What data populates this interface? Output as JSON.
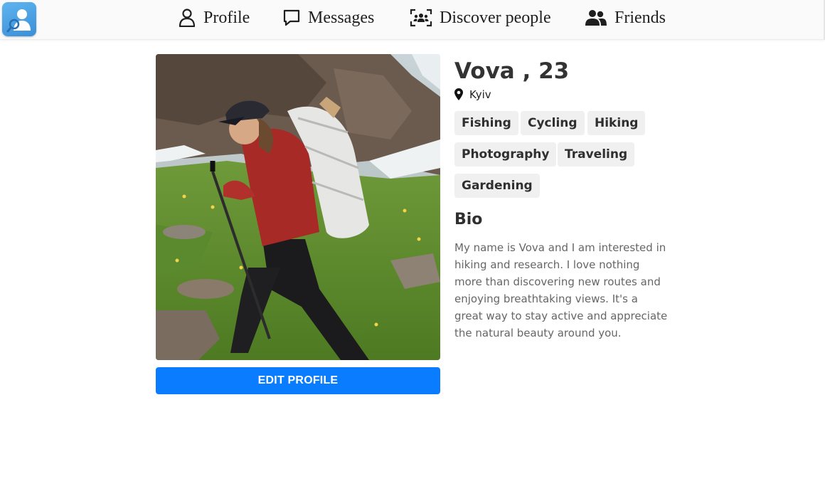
{
  "nav": {
    "items": [
      {
        "label": "Profile",
        "icon": "user-outline-icon"
      },
      {
        "label": "Messages",
        "icon": "chat-bubble-icon"
      },
      {
        "label": "Discover people",
        "icon": "discover-people-icon"
      },
      {
        "label": "Friends",
        "icon": "friends-icon"
      }
    ]
  },
  "profile": {
    "name": "Vova , 23",
    "location": "Kyiv",
    "interests": [
      "Fishing",
      "Cycling",
      "Hiking",
      "Photography",
      "Traveling",
      "Gardening"
    ],
    "bio_title": "Bio",
    "bio": "My name is Vova and I am interested in hiking and research. I love nothing more than discovering new routes and enjoying breathtaking views. It's a great way to stay active and appreciate the natural beauty around you.",
    "edit_label": "EDIT PROFILE"
  },
  "colors": {
    "accent": "#0a7cff",
    "logo": "#4aa3e6",
    "tag_bg": "#f0f0f0"
  }
}
